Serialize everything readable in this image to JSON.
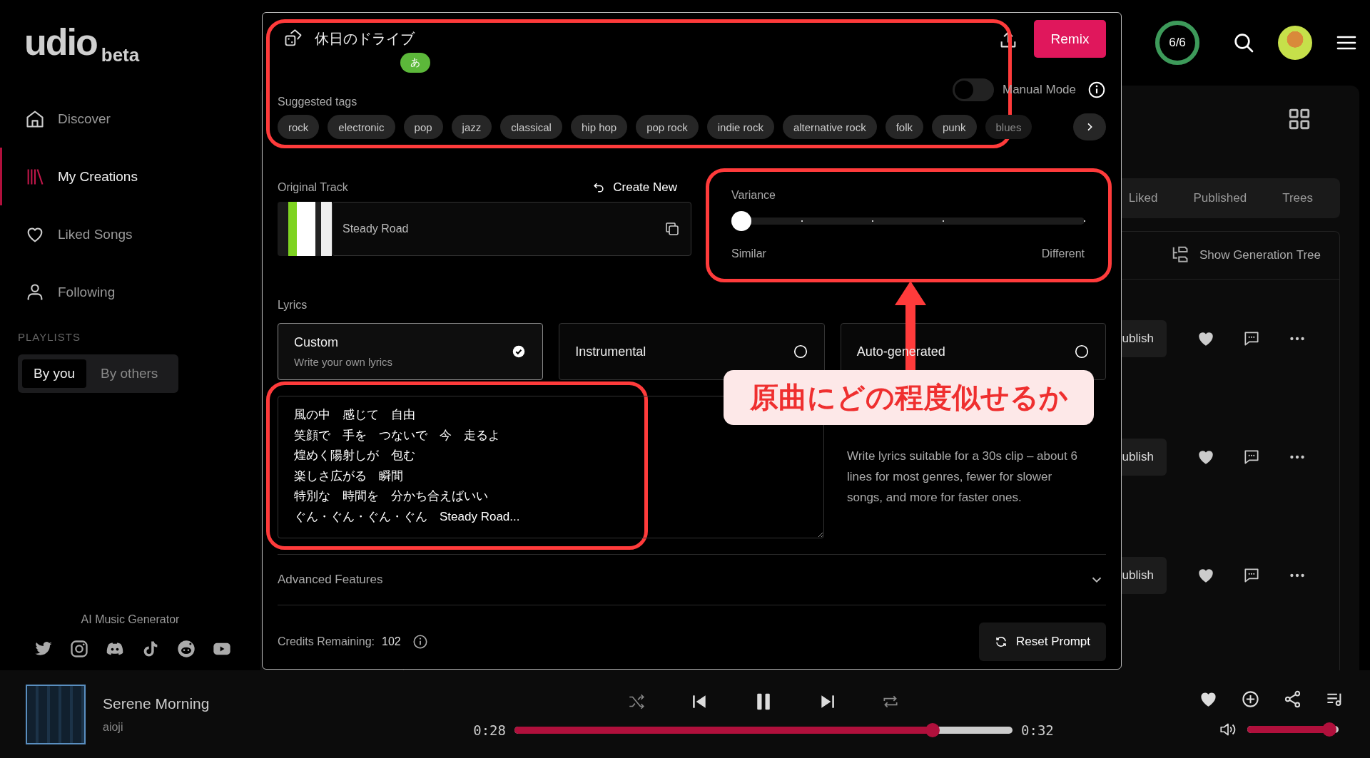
{
  "logo": {
    "name": "udio",
    "badge": "beta"
  },
  "sidebar": {
    "items": [
      {
        "label": "Discover",
        "selected": false
      },
      {
        "label": "My Creations",
        "selected": true
      },
      {
        "label": "Liked Songs",
        "selected": false
      },
      {
        "label": "Following",
        "selected": false
      }
    ],
    "playlists_heading": "PLAYLISTS",
    "playlist_tabs": [
      {
        "label": "By you",
        "selected": true
      },
      {
        "label": "By others",
        "selected": false
      }
    ],
    "tagline": "AI Music Generator"
  },
  "header": {
    "credits_ring": {
      "label": "6/6",
      "level": 1
    }
  },
  "library": {
    "view_tabs": [
      {
        "label": "Liked",
        "selected": false
      },
      {
        "label": "Published",
        "selected": false
      },
      {
        "label": "Trees",
        "selected": false
      }
    ],
    "tree_button": "Show Generation Tree",
    "rows": [
      {
        "button": "ublish"
      },
      {
        "button": "ublish"
      },
      {
        "button": "ublish"
      }
    ]
  },
  "modal": {
    "title": "休日のドライブ",
    "language_badge": "あ",
    "remix": "Remix",
    "manual_mode": {
      "label": "Manual Mode",
      "on": false
    },
    "suggested_tags": {
      "label": "Suggested tags",
      "tags": [
        {
          "label": "rock",
          "faded": false
        },
        {
          "label": "electronic",
          "faded": false
        },
        {
          "label": "pop",
          "faded": false
        },
        {
          "label": "jazz",
          "faded": false
        },
        {
          "label": "classical",
          "faded": false
        },
        {
          "label": "hip hop",
          "faded": false
        },
        {
          "label": "pop rock",
          "faded": false
        },
        {
          "label": "indie rock",
          "faded": false
        },
        {
          "label": "alternative rock",
          "faded": false
        },
        {
          "label": "folk",
          "faded": false
        },
        {
          "label": "punk",
          "faded": false
        },
        {
          "label": "blues",
          "faded": true
        }
      ]
    },
    "original_track": {
      "label": "Original Track",
      "create_new": "Create New",
      "name": "Steady Road"
    },
    "variance": {
      "label": "Variance",
      "level": 0,
      "min_label": "Similar",
      "max_label": "Different"
    },
    "lyrics": {
      "label": "Lyrics",
      "options": [
        {
          "title": "Custom",
          "subtitle": "Write your own lyrics",
          "selected": true
        },
        {
          "title": "Instrumental",
          "selected": false
        },
        {
          "title": "Auto-generated",
          "selected": false
        }
      ],
      "lines": [
        "風の中　感じて　自由",
        "笑顔で　手を　つないで　今　走るよ",
        "煌めく陽射しが　包む",
        "楽しさ広がる　瞬間",
        "特別な　時間を　分かち合えばいい",
        "ぐん・ぐん・ぐん・ぐん　Steady Road..."
      ],
      "hint": "Write lyrics suitable for a 30s clip – about 6 lines for most genres, fewer for slower songs, and more for faster ones."
    },
    "advanced": {
      "label": "Advanced Features",
      "expanded": false
    },
    "credits": {
      "label": "Credits Remaining:",
      "value": "102"
    },
    "reset": "Reset Prompt"
  },
  "annotation": {
    "callout": "原曲にどの程度似せるか"
  },
  "player": {
    "title": "Serene Morning",
    "artist": "aioji",
    "playing": true,
    "elapsed": "0:28",
    "duration": "0:32",
    "progress": {
      "level": 0.85
    },
    "volume": {
      "level": 0.97
    }
  }
}
